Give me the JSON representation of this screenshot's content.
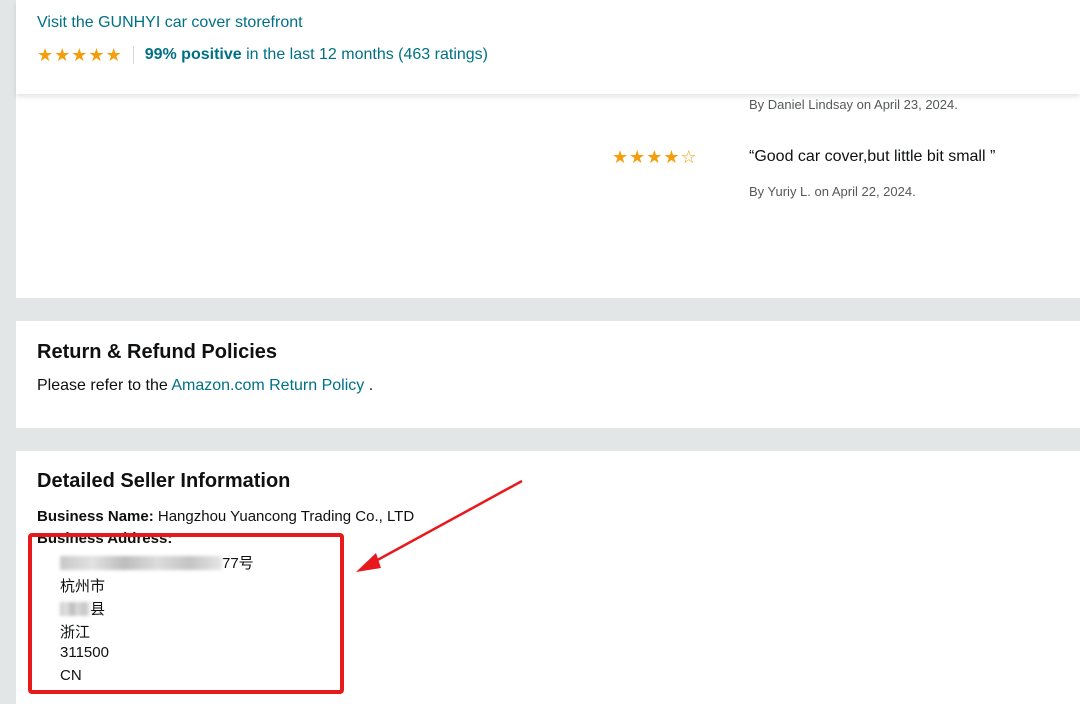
{
  "storefront": {
    "link_text": "Visit the GUNHYI car cover storefront",
    "rating_value": 5,
    "positive": "99% positive",
    "rating_suffix": " in the last 12 months (463 ratings)"
  },
  "reviews": [
    {
      "author_line": "By Daniel Lindsay on April 23, 2024."
    },
    {
      "stars": 4,
      "quote": "“Good car cover,but little bit small ”",
      "author_line": "By Yuriy L. on April 22, 2024."
    }
  ],
  "returns": {
    "title": "Return & Refund Policies",
    "text_before": "Please refer to the ",
    "link_text": "Amazon.com Return Policy",
    "text_after": " ."
  },
  "seller": {
    "title": "Detailed Seller Information",
    "business_name_label": "Business Name:",
    "business_name_value": " Hangzhou Yuancong Trading Co., LTD",
    "business_address_label": "Business Address:",
    "address_lines": [
      "77号",
      "杭州市",
      "县",
      "浙江",
      "311500",
      "CN"
    ]
  },
  "annotation": {
    "color": "#e8191c"
  },
  "colors": {
    "link": "#007185",
    "star": "#f59e0b",
    "background": "#e3e6e6"
  }
}
